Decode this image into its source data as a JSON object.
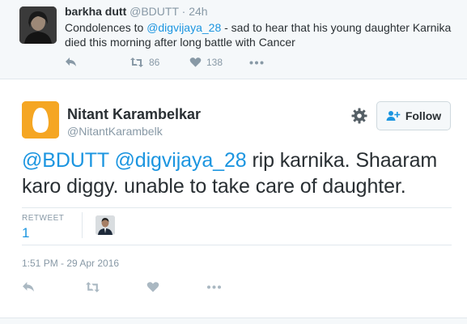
{
  "parent_tweet": {
    "name": "barkha dutt",
    "handle": "@BDUTT",
    "time": "24h",
    "text_before": "Condolences to ",
    "mention": "@digvijaya_28",
    "text_after": " - sad to hear that his young daughter Karnika died this morning after long battle with Cancer",
    "retweets": "86",
    "likes": "138",
    "icons": [
      "reply-icon",
      "retweet-icon",
      "heart-icon",
      "more-icon"
    ]
  },
  "main_tweet": {
    "name": "Nitant Karambelkar",
    "handle": "@NitantKarambelk",
    "follow_label": "Follow",
    "mention1": "@BDUTT",
    "mention2": "@digvijaya_28",
    "text": " rip karnika. Shaaram karo diggy.  unable to take care of daughter.",
    "retweet_label": "RETWEET",
    "retweet_count": "1",
    "timestamp": "1:51 PM - 29 Apr 2016",
    "icons": [
      "gear-icon",
      "add-user-icon",
      "reply-icon",
      "retweet-icon",
      "heart-icon",
      "more-icon"
    ]
  },
  "colors": {
    "link": "#1b95e0",
    "muted": "#8899a6",
    "text": "#292f33",
    "egg_avatar": "#f5a623"
  }
}
